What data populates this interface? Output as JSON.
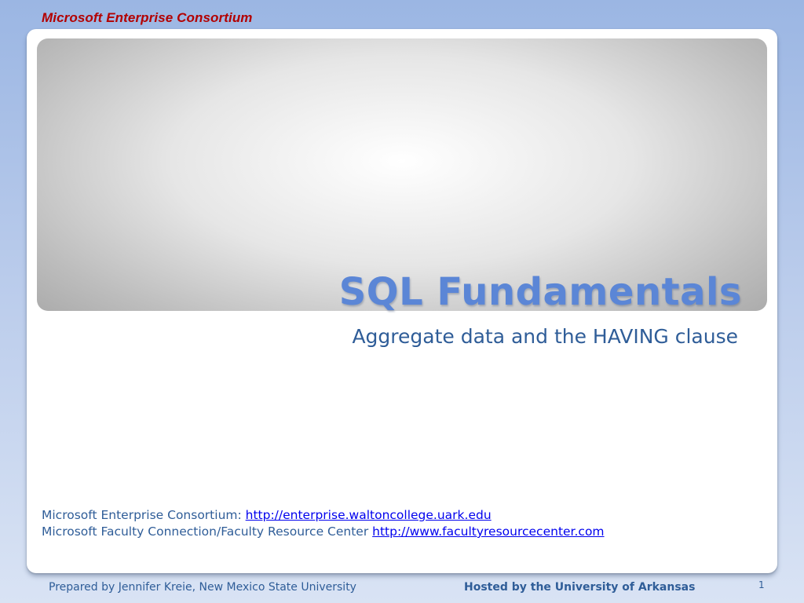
{
  "header": {
    "brand": "Microsoft Enterprise Consortium"
  },
  "slide": {
    "title": "SQL Fundamentals",
    "subtitle": "Aggregate data and the HAVING clause",
    "links": [
      {
        "prefix": "Microsoft Enterprise Consortium: ",
        "url_text": "http://enterprise.waltoncollege.uark.edu"
      },
      {
        "prefix": "Microsoft Faculty Connection/Faculty Resource Center ",
        "url_text": "http://www.facultyresourcecenter.com"
      }
    ]
  },
  "footer": {
    "prepared_by": "Prepared by Jennifer Kreie, New Mexico State University",
    "hosted_by": "Hosted by the University of Arkansas",
    "page_number": "1"
  },
  "colors": {
    "brand_red": "#b30000",
    "title_blue": "#5b86d6",
    "text_blue": "#2f5d98",
    "link_blue": "#0000ee"
  }
}
